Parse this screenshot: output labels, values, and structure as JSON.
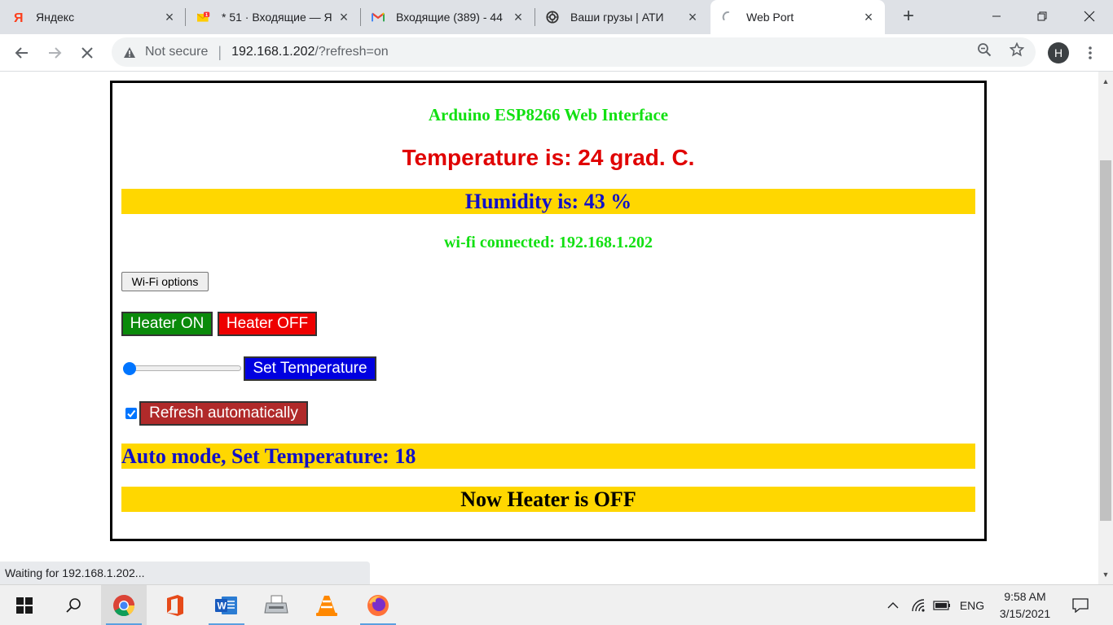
{
  "browser": {
    "tabs": [
      {
        "title": "Яндекс",
        "icon": "yandex-icon"
      },
      {
        "title": "* 51 · Входящие — Я",
        "icon": "yandex-mail-icon"
      },
      {
        "title": "Входящие (389) - 44",
        "icon": "gmail-icon"
      },
      {
        "title": "Ваши грузы | АТИ",
        "icon": "ati-icon"
      },
      {
        "title": "Web Port",
        "icon": "loading-spinner-icon",
        "active": true
      }
    ],
    "security_label": "Not secure",
    "url_host": "192.168.1.202",
    "url_path": "/?refresh=on",
    "profile_initial": "H",
    "status_text": "Waiting for 192.168.1.202..."
  },
  "page": {
    "heading": "Arduino ESP8266 Web Interface",
    "temperature": "Temperature is: 24 grad. C.",
    "humidity": "Humidity is: 43 %",
    "wifi_status": "wi-fi connected: 192.168.1.202",
    "wifi_button": "Wi-Fi options",
    "heater_on_button": "Heater ON",
    "heater_off_button": "Heater OFF",
    "set_temperature_button": "Set Temperature",
    "refresh_button": "Refresh automatically",
    "refresh_checked": true,
    "slider_fraction": 0.0,
    "auto_mode": "Auto mode, Set Temperature: 18",
    "heater_state": "Now Heater is OFF"
  },
  "taskbar": {
    "language": "ENG",
    "time": "9:58 AM",
    "date": "3/15/2021"
  },
  "colors": {
    "title_green": "#12e012",
    "temperature_red": "#e00000",
    "band_yellow": "#ffd700",
    "band_blue_text": "#1010c8",
    "heater_on_green": "#0a8a0a",
    "heater_off_red": "#ee0000",
    "set_temp_blue": "#0000e0",
    "refresh_brown": "#b02a2a"
  }
}
